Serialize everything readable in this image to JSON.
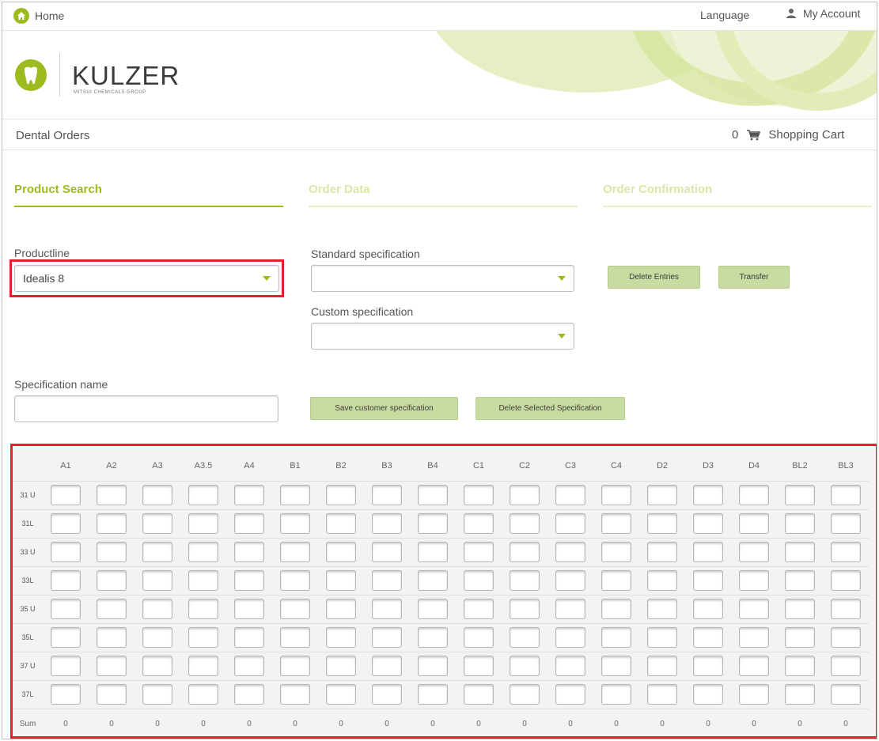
{
  "topbar": {
    "home": "Home",
    "language": "Language",
    "account": "My Account"
  },
  "brand": {
    "name": "KULZER",
    "sub": "MITSUI CHEMICALS GROUP"
  },
  "ordersbar": {
    "title": "Dental Orders",
    "cart_count": "0",
    "cart_label": "Shopping Cart"
  },
  "steps": [
    {
      "label": "Product Search",
      "active": true
    },
    {
      "label": "Order Data",
      "active": false
    },
    {
      "label": "Order Confirmation",
      "active": false
    }
  ],
  "form": {
    "productline_label": "Productline",
    "productline_value": "Idealis 8",
    "standard_label": "Standard specification",
    "standard_value": "",
    "custom_label": "Custom specification",
    "custom_value": "",
    "specname_label": "Specification name",
    "specname_value": "",
    "delete_entries": "Delete Entries",
    "transfer": "Transfer",
    "save_spec": "Save customer specification",
    "delete_spec": "Delete Selected Specification"
  },
  "grid": {
    "columns": [
      "A1",
      "A2",
      "A3",
      "A3.5",
      "A4",
      "B1",
      "B2",
      "B3",
      "B4",
      "C1",
      "C2",
      "C3",
      "C4",
      "D2",
      "D3",
      "D4",
      "BL2",
      "BL3"
    ],
    "rows": [
      "31 U",
      "31L",
      "33 U",
      "33L",
      "35 U",
      "35L",
      "37 U",
      "37L"
    ],
    "sum_label": "Sum",
    "sums": [
      "0",
      "0",
      "0",
      "0",
      "0",
      "0",
      "0",
      "0",
      "0",
      "0",
      "0",
      "0",
      "0",
      "0",
      "0",
      "0",
      "0",
      "0"
    ]
  },
  "colors": {
    "accent": "#9cbb1f",
    "accent_light": "#d8e7a6",
    "highlight": "#e3212a",
    "button": "#c8dba0"
  }
}
